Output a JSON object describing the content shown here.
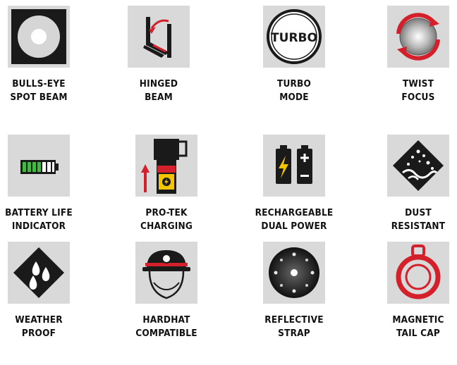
{
  "features": [
    {
      "icon": "bullseye-spot-beam-icon",
      "line1": "BULLS-EYE",
      "line2": "SPOT BEAM"
    },
    {
      "icon": "hinged-beam-icon",
      "line1": "HINGED",
      "line2": "BEAM"
    },
    {
      "icon": "turbo-mode-icon",
      "line1": "TURBO",
      "line2": "MODE",
      "badge": "TURBO"
    },
    {
      "icon": "twist-focus-icon",
      "line1": "TWIST",
      "line2": "FOCUS"
    },
    {
      "icon": "battery-life-icon",
      "line1": "BATTERY LIFE",
      "line2": "INDICATOR"
    },
    {
      "icon": "pro-tek-charging-icon",
      "line1": "PRO-TEK",
      "line2": "CHARGING"
    },
    {
      "icon": "dual-power-battery-icon",
      "line1": "RECHARGEABLE",
      "line2": "DUAL POWER"
    },
    {
      "icon": "dust-resistant-icon",
      "line1": "DUST",
      "line2": "RESISTANT"
    },
    {
      "icon": "weather-proof-icon",
      "line1": "WEATHER",
      "line2": "PROOF"
    },
    {
      "icon": "hardhat-compatible-icon",
      "line1": "HARDHAT",
      "line2": "COMPATIBLE"
    },
    {
      "icon": "reflective-strap-icon",
      "line1": "REFLECTIVE",
      "line2": "STRAP"
    },
    {
      "icon": "magnetic-tail-cap-icon",
      "line1": "MAGNETIC",
      "line2": "TAIL CAP"
    }
  ],
  "colors": {
    "tile": "#d9d9d9",
    "dark": "#1a1a1a",
    "accent_red": "#d4202a",
    "battery_green": "#3bbf3b",
    "bolt_yellow": "#f2c500"
  }
}
